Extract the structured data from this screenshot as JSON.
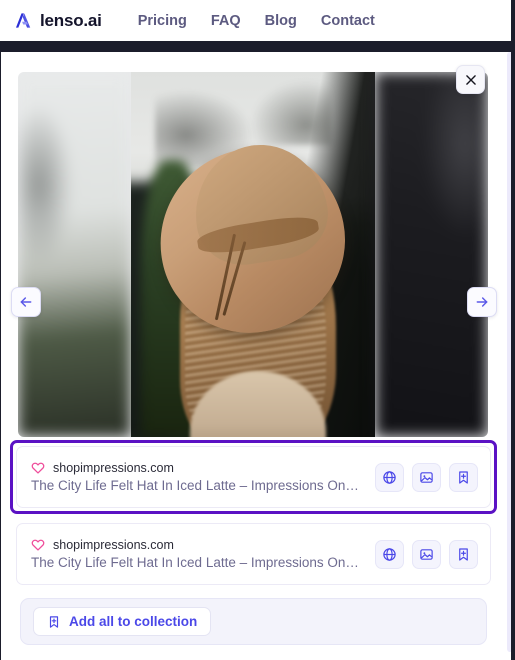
{
  "header": {
    "brand_name": "lenso.ai",
    "logo_icon": "lenso-mark-icon",
    "nav": [
      {
        "label": "Pricing"
      },
      {
        "label": "FAQ"
      },
      {
        "label": "Blog"
      },
      {
        "label": "Contact"
      }
    ]
  },
  "modal": {
    "close_icon": "close-icon",
    "carousel": {
      "prev_icon": "arrow-left-icon",
      "next_icon": "arrow-right-icon",
      "main_image_alt": "Woman seen from behind wearing a tan felt fedora hat with blonde wavy hair",
      "left_preview_alt": "Blurred previous image preview",
      "right_preview_alt": "Blurred next image preview"
    },
    "results": [
      {
        "selected": true,
        "favorite_icon": "heart-icon",
        "domain": "shopimpressions.com",
        "title": "The City Life Felt Hat In Iced Latte – Impressions Onli...",
        "actions": [
          {
            "icon": "globe-icon",
            "name": "open-website-button"
          },
          {
            "icon": "image-icon",
            "name": "open-image-button"
          },
          {
            "icon": "bookmark-plus-icon",
            "name": "add-to-collection-button"
          }
        ]
      },
      {
        "selected": false,
        "favorite_icon": "heart-icon",
        "domain": "shopimpressions.com",
        "title": "The City Life Felt Hat In Iced Latte – Impressions Onli...",
        "actions": [
          {
            "icon": "globe-icon",
            "name": "open-website-button"
          },
          {
            "icon": "image-icon",
            "name": "open-image-button"
          },
          {
            "icon": "bookmark-plus-icon",
            "name": "add-to-collection-button"
          }
        ]
      }
    ],
    "footer": {
      "add_all_icon": "bookmark-plus-icon",
      "add_all_label": "Add all to collection"
    }
  },
  "colors": {
    "brand_dark": "#14142b",
    "nav_text": "#5c5a80",
    "accent_indigo": "#4b48e8",
    "selection_purple": "#5b12c4",
    "heart_pink": "#ef4e9b",
    "title_muted": "#6e6b90",
    "panel_lavender": "#f3f3fb",
    "page_dark": "#1b1d2b"
  }
}
